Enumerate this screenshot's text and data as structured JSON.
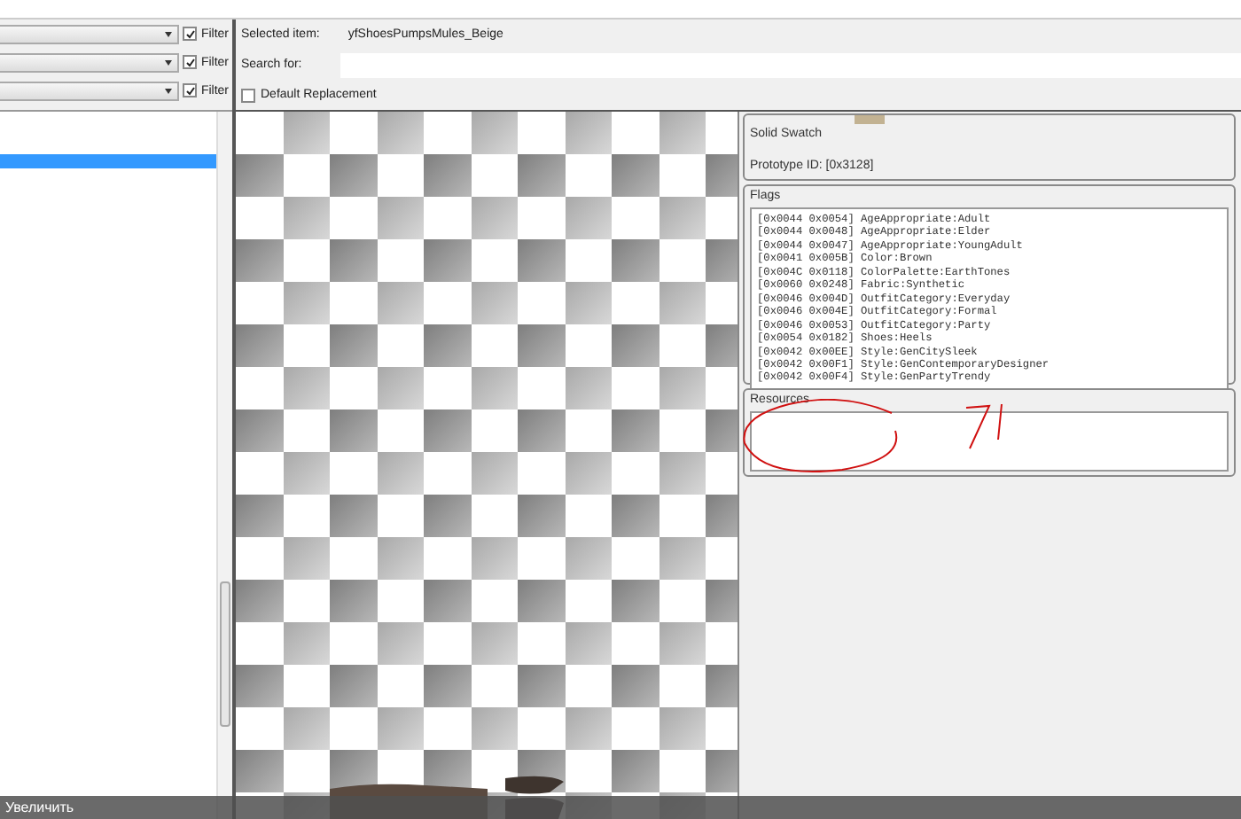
{
  "filters": [
    {
      "label": "Filter",
      "checked": true
    },
    {
      "label": "Filter",
      "checked": true
    },
    {
      "label": "Filter",
      "checked": true
    }
  ],
  "list": {
    "rows": [
      {
        "selected": true
      }
    ]
  },
  "selected_item": {
    "label": "Selected item:",
    "value": "yfShoesPumpsMules_Beige"
  },
  "search": {
    "label": "Search for:"
  },
  "default_replacement": {
    "label": "Default Replacement",
    "checked": false
  },
  "swatch_group": {
    "title": "Solid Swatch",
    "prototype_id": "Prototype ID: [0x3128]"
  },
  "flags_group": {
    "title": "Flags",
    "items": [
      "[0x0044 0x0054] AgeAppropriate:Adult",
      "[0x0044 0x0048] AgeAppropriate:Elder",
      "[0x0044 0x0047] AgeAppropriate:YoungAdult",
      "[0x0041 0x005B] Color:Brown",
      "[0x004C 0x0118] ColorPalette:EarthTones",
      "[0x0060 0x0248] Fabric:Synthetic",
      "[0x0046 0x004D] OutfitCategory:Everyday",
      "[0x0046 0x004E] OutfitCategory:Formal",
      "[0x0046 0x0053] OutfitCategory:Party",
      "[0x0054 0x0182] Shoes:Heels",
      "[0x0042 0x00EE] Style:GenCitySleek",
      "[0x0042 0x00F1] Style:GenContemporaryDesigner",
      "[0x0042 0x00F4] Style:GenPartyTrendy"
    ]
  },
  "resources_group": {
    "title": "Resources"
  },
  "status_bar": {
    "text": "Увеличить"
  }
}
